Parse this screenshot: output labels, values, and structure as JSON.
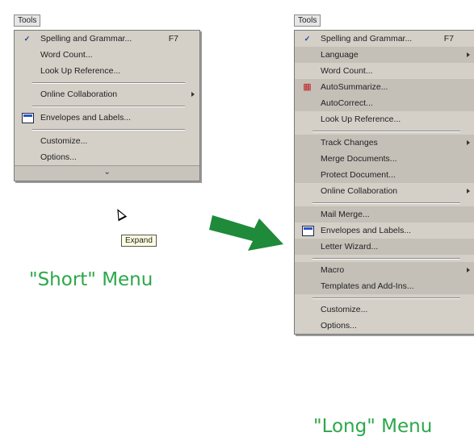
{
  "short_menu": {
    "title": "Tools",
    "items": [
      {
        "type": "item",
        "label": "Spelling and Grammar...",
        "shortcut": "F7",
        "icon": "spelling-icon"
      },
      {
        "type": "item",
        "label": "Word Count..."
      },
      {
        "type": "item",
        "label": "Look Up Reference..."
      },
      {
        "type": "separator"
      },
      {
        "type": "item",
        "label": "Online Collaboration",
        "submenu": true
      },
      {
        "type": "separator"
      },
      {
        "type": "item",
        "label": "Envelopes and Labels...",
        "icon": "envelope-icon"
      },
      {
        "type": "separator"
      },
      {
        "type": "item",
        "label": "Customize..."
      },
      {
        "type": "item",
        "label": "Options..."
      }
    ],
    "expand_glyph": "⌄"
  },
  "tooltip": "Expand",
  "short_caption": "\"Short\" Menu",
  "long_menu": {
    "title": "Tools",
    "items": [
      {
        "type": "item",
        "label": "Spelling and Grammar...",
        "shortcut": "F7",
        "icon": "spelling-icon"
      },
      {
        "type": "item",
        "label": "Language",
        "submenu": true,
        "recessed": true
      },
      {
        "type": "item",
        "label": "Word Count..."
      },
      {
        "type": "item",
        "label": "AutoSummarize...",
        "icon": "autosummarize-icon",
        "recessed": true
      },
      {
        "type": "item",
        "label": "AutoCorrect...",
        "recessed": true
      },
      {
        "type": "item",
        "label": "Look Up Reference..."
      },
      {
        "type": "separator"
      },
      {
        "type": "item",
        "label": "Track Changes",
        "submenu": true,
        "recessed": true
      },
      {
        "type": "item",
        "label": "Merge Documents...",
        "recessed": true
      },
      {
        "type": "item",
        "label": "Protect Document...",
        "recessed": true
      },
      {
        "type": "item",
        "label": "Online Collaboration",
        "submenu": true
      },
      {
        "type": "separator"
      },
      {
        "type": "item",
        "label": "Mail Merge...",
        "recessed": true
      },
      {
        "type": "item",
        "label": "Envelopes and Labels...",
        "icon": "envelope-icon"
      },
      {
        "type": "item",
        "label": "Letter Wizard...",
        "recessed": true
      },
      {
        "type": "separator"
      },
      {
        "type": "item",
        "label": "Macro",
        "submenu": true,
        "recessed": true
      },
      {
        "type": "item",
        "label": "Templates and Add-Ins...",
        "recessed": true
      },
      {
        "type": "separator"
      },
      {
        "type": "item",
        "label": "Customize..."
      },
      {
        "type": "item",
        "label": "Options..."
      }
    ]
  },
  "long_caption": "\"Long\" Menu",
  "colors": {
    "caption": "#2ca84a",
    "arrow": "#1f8a3a",
    "menu_bg": "#d4d0c8"
  }
}
